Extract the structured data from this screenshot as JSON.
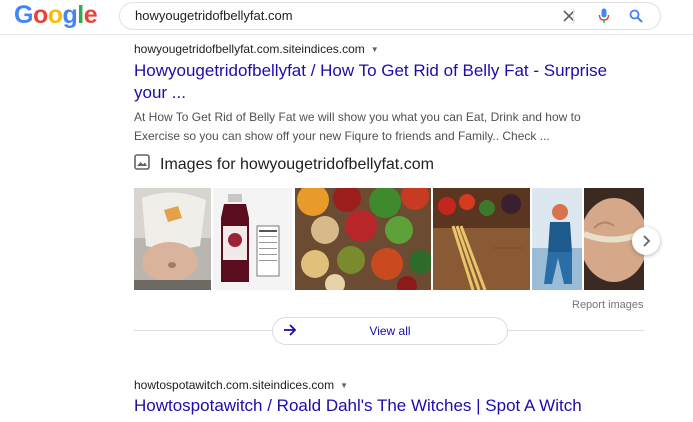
{
  "header": {
    "logo_letters": [
      {
        "ch": "G",
        "color": "#4285F4"
      },
      {
        "ch": "o",
        "color": "#EA4335"
      },
      {
        "ch": "o",
        "color": "#FBBC05"
      },
      {
        "ch": "g",
        "color": "#4285F4"
      },
      {
        "ch": "l",
        "color": "#34A853"
      },
      {
        "ch": "e",
        "color": "#EA4335"
      }
    ],
    "query": "howyougetridofbellyfat.com",
    "icons": [
      "close-icon",
      "microphone-icon",
      "search-icon"
    ]
  },
  "result1": {
    "cite": "howyougetridofbellyfat.com.siteindices.com",
    "title": "Howyougetridofbellyfat / How To Get Rid of Belly Fat - Surprise your ...",
    "snippet": "At How To Get Rid of Belly Fat we will show you what you can Eat, Drink and how to Exercise so you can show off your new Fiqure to friends and Family.. Check ..."
  },
  "images": {
    "heading": "Images for howyougetridofbellyfat.com",
    "report_label": "Report images",
    "view_all_label": "View all"
  },
  "result2": {
    "cite": "howtospotawitch.com.siteindices.com",
    "title": "Howtospotawitch / Roald Dahl's The Witches | Spot A Witch"
  },
  "colors": {
    "link": "#1a0dab",
    "google_blue": "#4285F4"
  }
}
